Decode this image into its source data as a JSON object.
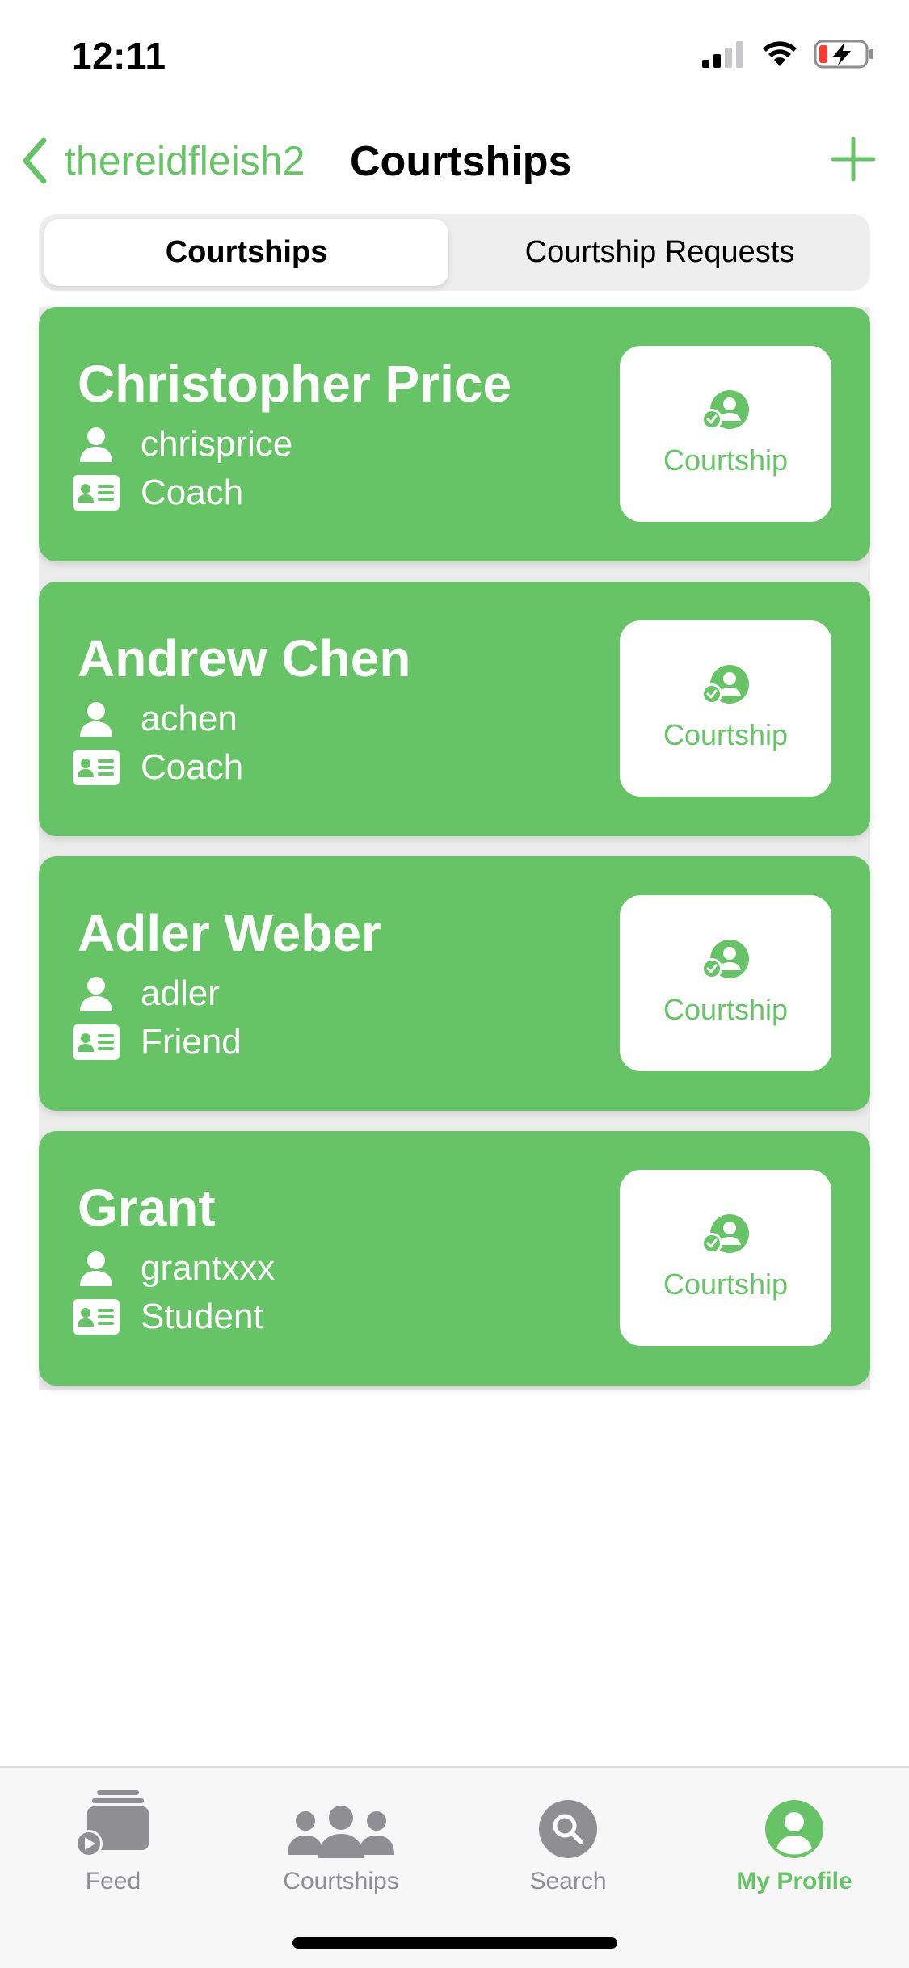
{
  "status_bar": {
    "time": "12:11"
  },
  "nav": {
    "back_label": "thereidfleish2",
    "title": "Courtships"
  },
  "segmented": {
    "options": [
      "Courtships",
      "Courtship Requests"
    ],
    "selected": "Courtships"
  },
  "courtships": [
    {
      "name": "Christopher Price",
      "username": "chrisprice",
      "role": "Coach",
      "button_label": "Courtship"
    },
    {
      "name": "Andrew Chen",
      "username": "achen",
      "role": "Coach",
      "button_label": "Courtship"
    },
    {
      "name": "Adler Weber",
      "username": "adler",
      "role": "Friend",
      "button_label": "Courtship"
    },
    {
      "name": "Grant",
      "username": "grantxxx",
      "role": "Student",
      "button_label": "Courtship"
    }
  ],
  "tab_bar": {
    "tabs": [
      {
        "label": "Feed",
        "icon": "feed-icon"
      },
      {
        "label": "Courtships",
        "icon": "group-icon"
      },
      {
        "label": "Search",
        "icon": "search-icon"
      },
      {
        "label": "My Profile",
        "icon": "profile-icon"
      }
    ],
    "active": "My Profile"
  },
  "colors": {
    "accent": "#67c466",
    "inactive": "#8e8e93",
    "card_bg": "#67c466"
  }
}
